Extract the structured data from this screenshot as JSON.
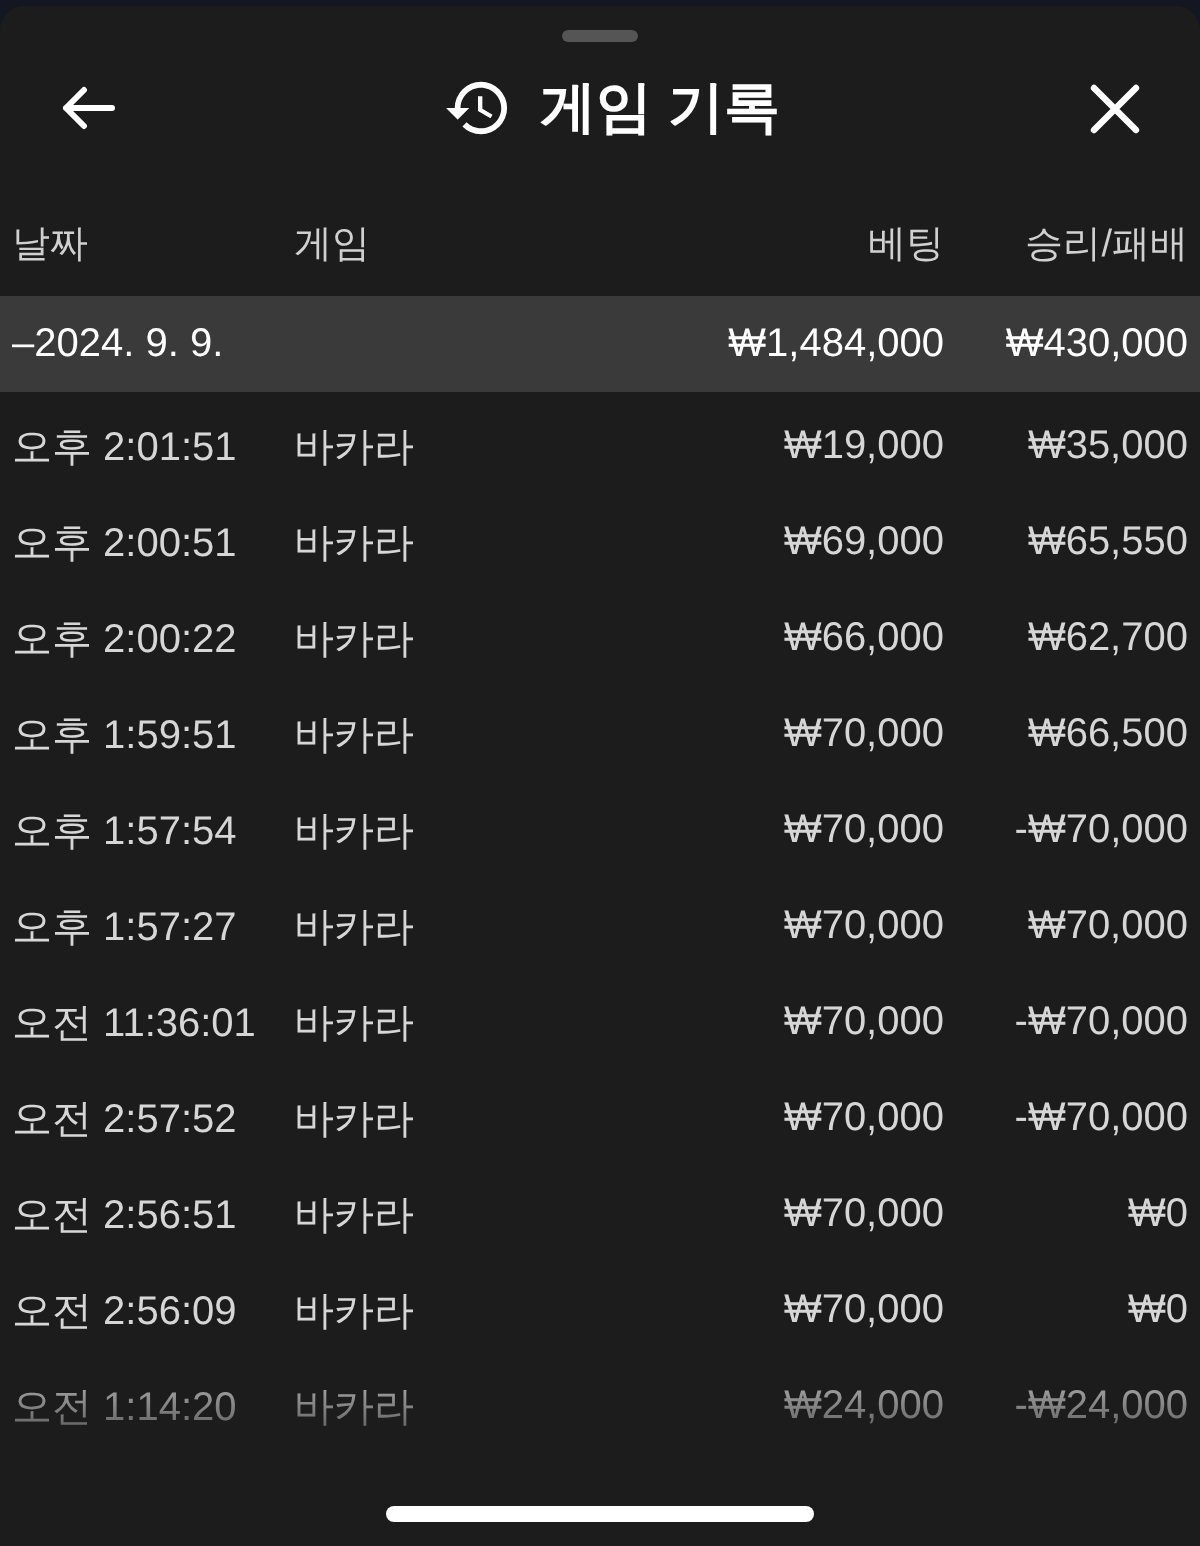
{
  "sheet": {
    "title": "게임 기록"
  },
  "table": {
    "columns": [
      "날짜",
      "게임",
      "베팅",
      "승리/패배"
    ],
    "summary": {
      "date": "–2024. 9. 9.",
      "bet": "₩1,484,000",
      "result": "₩430,000"
    },
    "rows": [
      {
        "time": "오후 2:01:51",
        "game": "바카라",
        "bet": "₩19,000",
        "result": "₩35,000"
      },
      {
        "time": "오후 2:00:51",
        "game": "바카라",
        "bet": "₩69,000",
        "result": "₩65,550"
      },
      {
        "time": "오후 2:00:22",
        "game": "바카라",
        "bet": "₩66,000",
        "result": "₩62,700"
      },
      {
        "time": "오후 1:59:51",
        "game": "바카라",
        "bet": "₩70,000",
        "result": "₩66,500"
      },
      {
        "time": "오후 1:57:54",
        "game": "바카라",
        "bet": "₩70,000",
        "result": "-₩70,000"
      },
      {
        "time": "오후 1:57:27",
        "game": "바카라",
        "bet": "₩70,000",
        "result": "₩70,000"
      },
      {
        "time": "오전 11:36:01",
        "game": "바카라",
        "bet": "₩70,000",
        "result": "-₩70,000"
      },
      {
        "time": "오전 2:57:52",
        "game": "바카라",
        "bet": "₩70,000",
        "result": "-₩70,000"
      },
      {
        "time": "오전 2:56:51",
        "game": "바카라",
        "bet": "₩70,000",
        "result": "₩0"
      },
      {
        "time": "오전 2:56:09",
        "game": "바카라",
        "bet": "₩70,000",
        "result": "₩0"
      },
      {
        "time": "오전 1:14:20",
        "game": "바카라",
        "bet": "₩24,000",
        "result": "-₩24,000"
      }
    ]
  }
}
